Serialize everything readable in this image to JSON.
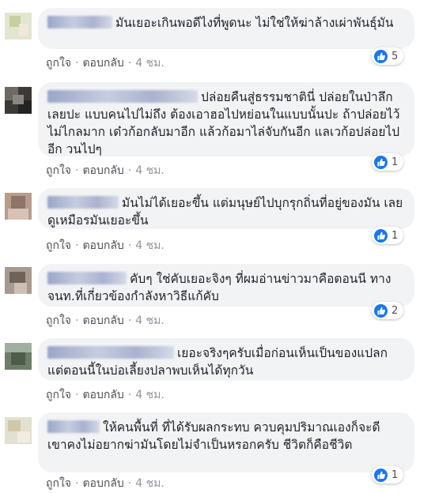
{
  "actions": {
    "like": "ถูกใจ",
    "separator": "·",
    "reply": "ตอบกลับ"
  },
  "reaction_icon": "like-thumb-icon",
  "accent_color": "#1877f2",
  "comments": [
    {
      "name_visible": "Jan Dee",
      "text": "มันเยอะเกินพอดีไงที่พูดนะ ไม่ใช่ให้ฆ่าล้างเผ่าพันธุ์มัน",
      "time": "4 ชม.",
      "likes": "5"
    },
    {
      "text": "ปล่อยคืนสู่ธรรมชาตินี่ ปล่อยในป่าลึกเลยปะ แบบคนไปไม่ถึง ต้องเอาฮอไปหย่อนในแบบนั้นปะ ถ้าปล่อยไว้ไม่ไกลมาก เด๋วก้อกลับมาอีก แล้วก้อมาไล่จับกันอีก แลเวก้อปล่อยไปอีก วนไปๆ",
      "time": "4 ชม.",
      "likes": "1"
    },
    {
      "text": "มันไม่ได้เยอะขึ้น แต่มนุษย์ไปบุกรุกถิ่นที่อยู่ของมัน เลยดูเหมือรมันเยอะขึ้น",
      "time": "4 ชม.",
      "likes": "1"
    },
    {
      "text": "คับๆ ใช่คับเยอะจิงๆ ที่ผมอ่านข่าวมาคือตอนนี ทางจนท.ที่เกี่ยวข้องกำลังหาวิธีแก้คับ",
      "time": "4 ชม.",
      "likes": "2"
    },
    {
      "text": "เยอะจริงๆครับเมื่อก่อนเห็นเป็นของแปลกแต่ตอนนี้ในบ่อเลี้ยงปลาพบเห็นได้ทุกวัน",
      "time": "4 ชม."
    },
    {
      "text": "ให้คนพื้นที่ ที่ได้รับผลกระทบ ควบคุมปริมาณเองก็จะดี เขาคงไม่อยากฆ่ามันโดยไม่จำเป็นหรอกครับ ชีวิตก็คือชีวิต",
      "time": "4 ชม.",
      "likes": "1"
    }
  ]
}
